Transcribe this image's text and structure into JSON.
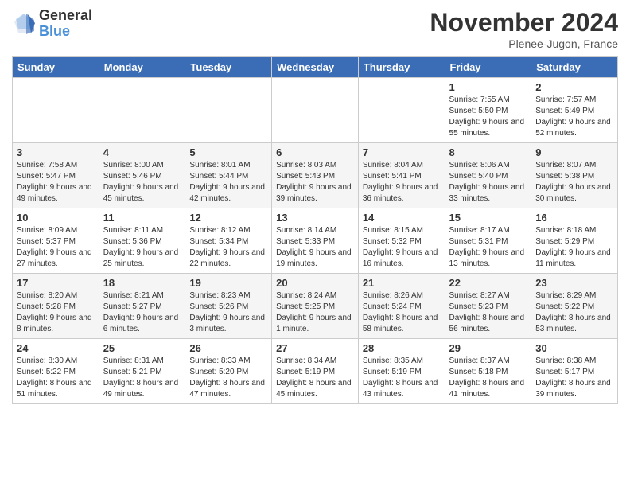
{
  "logo": {
    "general": "General",
    "blue": "Blue"
  },
  "header": {
    "month_year": "November 2024",
    "location": "Plenee-Jugon, France"
  },
  "columns": [
    "Sunday",
    "Monday",
    "Tuesday",
    "Wednesday",
    "Thursday",
    "Friday",
    "Saturday"
  ],
  "weeks": [
    [
      {
        "day": "",
        "info": ""
      },
      {
        "day": "",
        "info": ""
      },
      {
        "day": "",
        "info": ""
      },
      {
        "day": "",
        "info": ""
      },
      {
        "day": "",
        "info": ""
      },
      {
        "day": "1",
        "info": "Sunrise: 7:55 AM\nSunset: 5:50 PM\nDaylight: 9 hours and 55 minutes."
      },
      {
        "day": "2",
        "info": "Sunrise: 7:57 AM\nSunset: 5:49 PM\nDaylight: 9 hours and 52 minutes."
      }
    ],
    [
      {
        "day": "3",
        "info": "Sunrise: 7:58 AM\nSunset: 5:47 PM\nDaylight: 9 hours and 49 minutes."
      },
      {
        "day": "4",
        "info": "Sunrise: 8:00 AM\nSunset: 5:46 PM\nDaylight: 9 hours and 45 minutes."
      },
      {
        "day": "5",
        "info": "Sunrise: 8:01 AM\nSunset: 5:44 PM\nDaylight: 9 hours and 42 minutes."
      },
      {
        "day": "6",
        "info": "Sunrise: 8:03 AM\nSunset: 5:43 PM\nDaylight: 9 hours and 39 minutes."
      },
      {
        "day": "7",
        "info": "Sunrise: 8:04 AM\nSunset: 5:41 PM\nDaylight: 9 hours and 36 minutes."
      },
      {
        "day": "8",
        "info": "Sunrise: 8:06 AM\nSunset: 5:40 PM\nDaylight: 9 hours and 33 minutes."
      },
      {
        "day": "9",
        "info": "Sunrise: 8:07 AM\nSunset: 5:38 PM\nDaylight: 9 hours and 30 minutes."
      }
    ],
    [
      {
        "day": "10",
        "info": "Sunrise: 8:09 AM\nSunset: 5:37 PM\nDaylight: 9 hours and 27 minutes."
      },
      {
        "day": "11",
        "info": "Sunrise: 8:11 AM\nSunset: 5:36 PM\nDaylight: 9 hours and 25 minutes."
      },
      {
        "day": "12",
        "info": "Sunrise: 8:12 AM\nSunset: 5:34 PM\nDaylight: 9 hours and 22 minutes."
      },
      {
        "day": "13",
        "info": "Sunrise: 8:14 AM\nSunset: 5:33 PM\nDaylight: 9 hours and 19 minutes."
      },
      {
        "day": "14",
        "info": "Sunrise: 8:15 AM\nSunset: 5:32 PM\nDaylight: 9 hours and 16 minutes."
      },
      {
        "day": "15",
        "info": "Sunrise: 8:17 AM\nSunset: 5:31 PM\nDaylight: 9 hours and 13 minutes."
      },
      {
        "day": "16",
        "info": "Sunrise: 8:18 AM\nSunset: 5:29 PM\nDaylight: 9 hours and 11 minutes."
      }
    ],
    [
      {
        "day": "17",
        "info": "Sunrise: 8:20 AM\nSunset: 5:28 PM\nDaylight: 9 hours and 8 minutes."
      },
      {
        "day": "18",
        "info": "Sunrise: 8:21 AM\nSunset: 5:27 PM\nDaylight: 9 hours and 6 minutes."
      },
      {
        "day": "19",
        "info": "Sunrise: 8:23 AM\nSunset: 5:26 PM\nDaylight: 9 hours and 3 minutes."
      },
      {
        "day": "20",
        "info": "Sunrise: 8:24 AM\nSunset: 5:25 PM\nDaylight: 9 hours and 1 minute."
      },
      {
        "day": "21",
        "info": "Sunrise: 8:26 AM\nSunset: 5:24 PM\nDaylight: 8 hours and 58 minutes."
      },
      {
        "day": "22",
        "info": "Sunrise: 8:27 AM\nSunset: 5:23 PM\nDaylight: 8 hours and 56 minutes."
      },
      {
        "day": "23",
        "info": "Sunrise: 8:29 AM\nSunset: 5:22 PM\nDaylight: 8 hours and 53 minutes."
      }
    ],
    [
      {
        "day": "24",
        "info": "Sunrise: 8:30 AM\nSunset: 5:22 PM\nDaylight: 8 hours and 51 minutes."
      },
      {
        "day": "25",
        "info": "Sunrise: 8:31 AM\nSunset: 5:21 PM\nDaylight: 8 hours and 49 minutes."
      },
      {
        "day": "26",
        "info": "Sunrise: 8:33 AM\nSunset: 5:20 PM\nDaylight: 8 hours and 47 minutes."
      },
      {
        "day": "27",
        "info": "Sunrise: 8:34 AM\nSunset: 5:19 PM\nDaylight: 8 hours and 45 minutes."
      },
      {
        "day": "28",
        "info": "Sunrise: 8:35 AM\nSunset: 5:19 PM\nDaylight: 8 hours and 43 minutes."
      },
      {
        "day": "29",
        "info": "Sunrise: 8:37 AM\nSunset: 5:18 PM\nDaylight: 8 hours and 41 minutes."
      },
      {
        "day": "30",
        "info": "Sunrise: 8:38 AM\nSunset: 5:17 PM\nDaylight: 8 hours and 39 minutes."
      }
    ]
  ]
}
